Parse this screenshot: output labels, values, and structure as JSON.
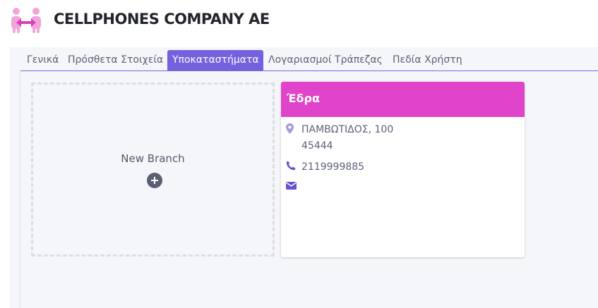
{
  "header": {
    "company_name": "CELLPHONES COMPANY AE",
    "logo_icon": "handshake-logo-icon"
  },
  "tabs": [
    {
      "label": "Γενικά",
      "active": false
    },
    {
      "label": "Πρόσθετα Στοιχεία",
      "active": false
    },
    {
      "label": "Υποκαταστήματα",
      "active": true
    },
    {
      "label": "Λογαριασμοί Τράπεζας",
      "active": false
    },
    {
      "label": "Πεδία Χρήστη",
      "active": false
    }
  ],
  "new_branch": {
    "label": "New Branch",
    "icon": "plus-circle-icon"
  },
  "branch": {
    "name": "Έδρα",
    "address_line1": "ΠΑΜΒΩΤΙΔΟΣ, 100",
    "address_line2": "45444",
    "phone": "2119999885",
    "email": "",
    "icons": {
      "address": "map-pin-icon",
      "phone": "phone-icon",
      "email": "envelope-icon"
    }
  },
  "colors": {
    "accent": "#7561dd",
    "branch_header": "#e044cb",
    "logo_pink": "#f0a6d9",
    "logo_magenta": "#d93fbd",
    "panel_bg": "#f5f6f9",
    "icon_purple": "#6a4fcf"
  }
}
